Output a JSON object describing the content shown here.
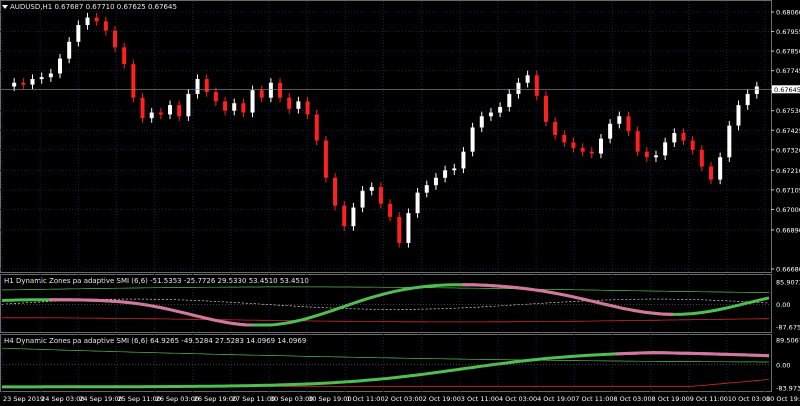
{
  "header": {
    "symbol": "AUDUSD,H1",
    "ohlc": "0.67687 0.67710 0.67625 0.67645"
  },
  "chart_data": [
    {
      "type": "candlestick",
      "title": "AUDUSD,H1",
      "ylim": [
        0.6668,
        0.6806
      ],
      "y_ticks": [
        "0.68060",
        "0.67955",
        "0.67850",
        "0.67745",
        "0.67645",
        "0.67530",
        "0.67425",
        "0.67320",
        "0.67210",
        "0.67105",
        "0.67000",
        "0.66890",
        "0.66680"
      ],
      "current_price": "0.67645",
      "x_ticks": [
        "23 Sep 2019",
        "24 Sep 03:00",
        "24 Sep 19:00",
        "25 Sep 11:00",
        "26 Sep 03:00",
        "26 Sep 19:00",
        "27 Sep 11:00",
        "30 Sep 03:00",
        "30 Sep 19:00",
        "1 Oct 11:00",
        "2 Oct 03:00",
        "2 Oct 19:00",
        "3 Oct 11:00",
        "4 Oct 03:00",
        "4 Oct 19:00",
        "7 Oct 11:00",
        "8 Oct 03:00",
        "8 Oct 19:00",
        "9 Oct 11:00",
        "10 Oct 03:00",
        "10 Oct 19:00"
      ],
      "close_series": [
        0.6766,
        0.6768,
        0.6767,
        0.677,
        0.6771,
        0.6773,
        0.6781,
        0.679,
        0.6799,
        0.6803,
        0.6801,
        0.6796,
        0.6787,
        0.6778,
        0.676,
        0.6749,
        0.6752,
        0.6751,
        0.6756,
        0.675,
        0.6762,
        0.677,
        0.6763,
        0.6758,
        0.6753,
        0.6757,
        0.6752,
        0.6764,
        0.676,
        0.6768,
        0.676,
        0.6754,
        0.6758,
        0.6751,
        0.6737,
        0.6717,
        0.6702,
        0.6691,
        0.6701,
        0.671,
        0.6712,
        0.6703,
        0.6696,
        0.6682,
        0.6698,
        0.6709,
        0.6713,
        0.6717,
        0.6721,
        0.6722,
        0.6731,
        0.6744,
        0.675,
        0.6752,
        0.6755,
        0.6762,
        0.6768,
        0.6772,
        0.6761,
        0.6747,
        0.674,
        0.6736,
        0.6733,
        0.6731,
        0.673,
        0.6738,
        0.6746,
        0.675,
        0.6742,
        0.6731,
        0.6728,
        0.6729,
        0.6736,
        0.6741,
        0.6737,
        0.6732,
        0.6723,
        0.6716,
        0.6728,
        0.6745,
        0.6756,
        0.6762,
        0.6766
      ]
    },
    {
      "type": "line",
      "title": "H1 Dynamic Zones pa adaptive SMI (6,6)",
      "values_text": "-51.5353 -25.7726 29.5330 53.4510 53.4510",
      "ylim": [
        -87.6751,
        85.9073
      ],
      "y_ticks": [
        "85.9073",
        "0.00",
        "-87.6751"
      ]
    },
    {
      "type": "line",
      "title": "H4 Dynamic Zones pa adaptive SMI (6,6)",
      "values_text": "64.9265 -49.5284 27.5283 14.0969 14.0969",
      "ylim": [
        -83.9737,
        89.5067
      ],
      "y_ticks": [
        "89.5067",
        "0.00",
        "-83.9737"
      ]
    }
  ],
  "colors": {
    "background": "#000000",
    "bull_candle": "#ffffff",
    "bear_candle": "#ff2020",
    "grid": "#1b1b55",
    "smi_line": "#4fc04f",
    "smi_down": "#d9739f",
    "level_line": "#d42a2a",
    "signal_line": "#ffffff"
  }
}
